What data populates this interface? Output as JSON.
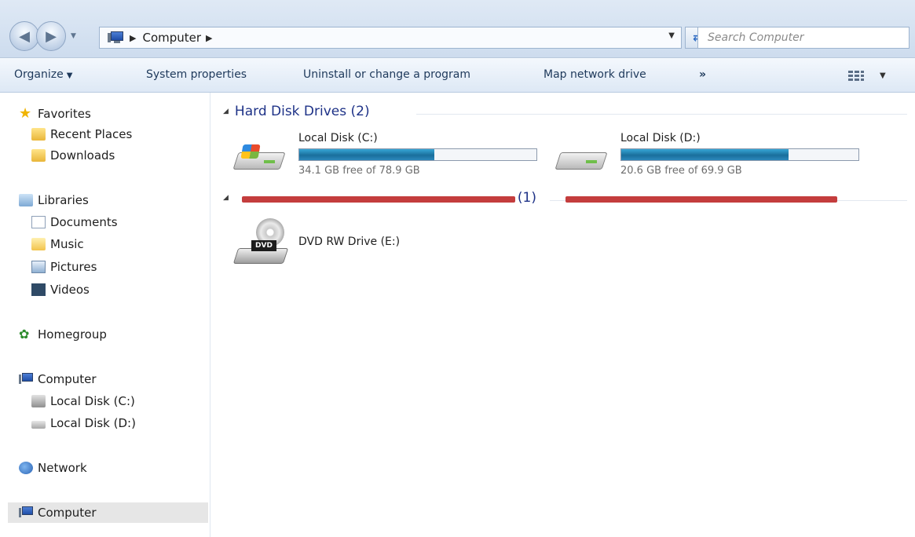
{
  "address_bar": {
    "crumbs": [
      "Computer"
    ],
    "search_placeholder": "Search Computer"
  },
  "toolbar": {
    "organize": "Organize",
    "system_properties": "System properties",
    "uninstall": "Uninstall or change a program",
    "map_drive": "Map network drive",
    "more": "»"
  },
  "sidebar": {
    "favorites": "Favorites",
    "recent_places": "Recent Places",
    "downloads": "Downloads",
    "libraries": "Libraries",
    "documents": "Documents",
    "music": "Music",
    "pictures": "Pictures",
    "videos": "Videos",
    "homegroup": "Homegroup",
    "computer": "Computer",
    "local_c": "Local Disk (C:)",
    "local_d": "Local Disk (D:)",
    "network": "Network",
    "computer_bottom": "Computer"
  },
  "content": {
    "hard_disk_group": "Hard Disk Drives (2)",
    "removable_group_visible": "(1)",
    "drives": [
      {
        "name": "Local Disk (C:)",
        "free_text": "34.1 GB free of 78.9 GB",
        "used_fraction": 0.568
      },
      {
        "name": "Local Disk (D:)",
        "free_text": "20.6 GB free of 69.9 GB",
        "used_fraction": 0.705
      }
    ],
    "dvd": {
      "name": "DVD RW Drive (E:)",
      "label": "DVD"
    }
  },
  "colors": {
    "group_heading": "#1e3287",
    "bar_fill": "#1a6f9c",
    "redaction": "#c43d3d"
  }
}
